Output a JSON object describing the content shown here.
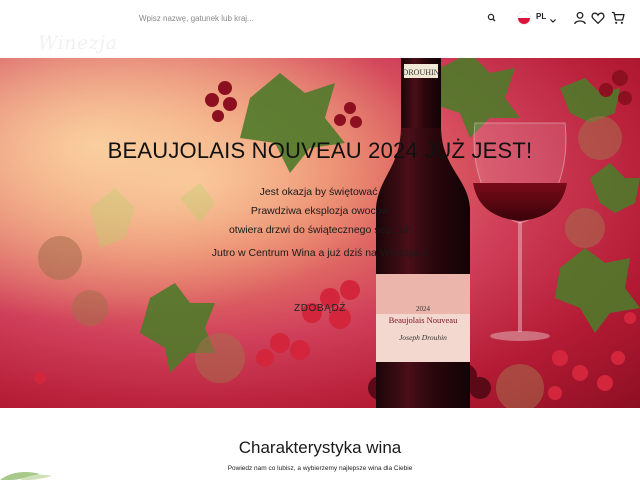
{
  "header": {
    "logo_text": "Winezja",
    "search_placeholder": "Wpisz nazwę, gatunek lub kraj...",
    "language": "PL",
    "icons": [
      "search-icon",
      "user-icon",
      "heart-icon",
      "cart-icon"
    ]
  },
  "hero": {
    "title": "BEAUJOLAIS NOUVEAU 2024 JUŻ JEST!",
    "lines": [
      "Jest okazja by świętować.",
      "Prawdziwa eksplozja owoców",
      "otwiera drzwi do świątecznego sezonu!",
      "Jutro w Centrum Wina a już dziś na Winezja.pl"
    ],
    "cta": "ZDOBĄDŹ",
    "bottle": {
      "brand": "DROUHIN",
      "vintage": "2024",
      "name": "Beaujolais Nouveau",
      "producer": "Joseph Drouhin"
    }
  },
  "section": {
    "title": "Charakterystyka wina",
    "subtitle": "Powiedz nam co lubisz, a wybierzemy najlepsze wina dla Ciebie"
  },
  "colors": {
    "accent": "#c01a35",
    "flag_red": "#dc143c"
  }
}
